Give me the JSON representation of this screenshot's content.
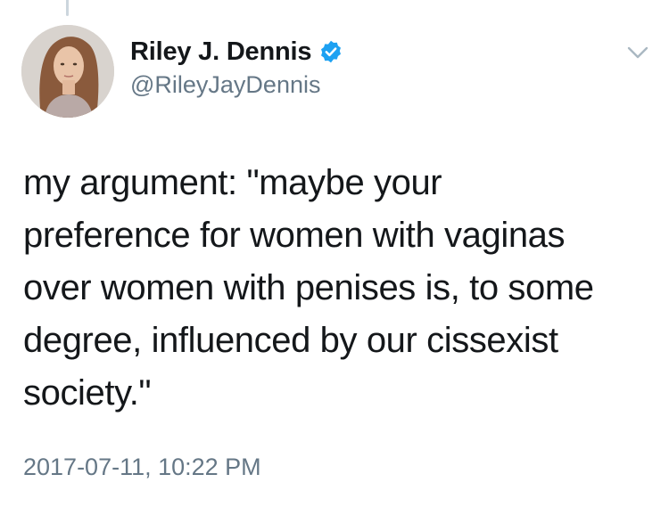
{
  "tweet": {
    "author": {
      "display_name": "Riley J. Dennis",
      "handle": "@RileyJayDennis",
      "verified": true
    },
    "text": "my argument: \"maybe your\npreference for women with vaginas\nover women with penises is, to some\ndegree, influenced by our cissexist\nsociety.\"",
    "timestamp": "2017-07-11, 10:22 PM"
  },
  "colors": {
    "text_primary": "#14171a",
    "text_secondary": "#657786",
    "verified_blue": "#1da1f2",
    "thread_line": "#ccd6dd"
  },
  "icons": {
    "verified": "verified-badge-icon",
    "more": "chevron-down-icon"
  }
}
